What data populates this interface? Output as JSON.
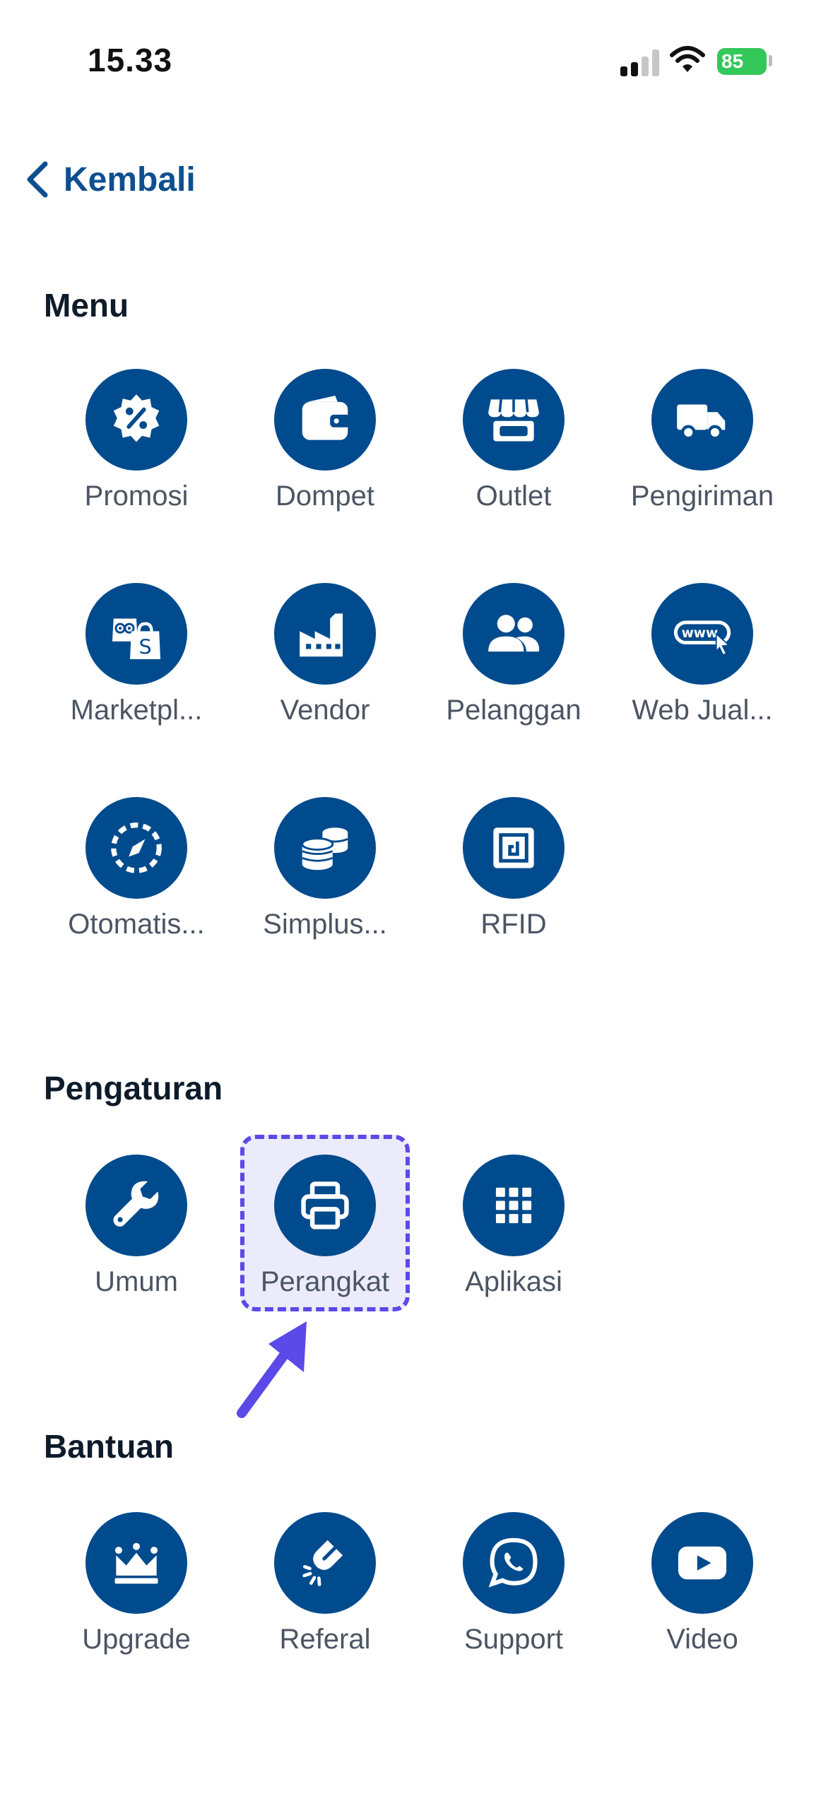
{
  "status_bar": {
    "time": "15.33",
    "battery": "85"
  },
  "nav": {
    "back_label": "Kembali"
  },
  "sections": {
    "menu": {
      "title": "Menu",
      "items": [
        {
          "label": "Promosi",
          "icon": "discount-badge-icon"
        },
        {
          "label": "Dompet",
          "icon": "wallet-icon"
        },
        {
          "label": "Outlet",
          "icon": "store-icon"
        },
        {
          "label": "Pengiriman",
          "icon": "truck-icon"
        },
        {
          "label": "Marketpl...",
          "icon": "marketplace-icon"
        },
        {
          "label": "Vendor",
          "icon": "factory-icon"
        },
        {
          "label": "Pelanggan",
          "icon": "customers-icon"
        },
        {
          "label": "Web Jual...",
          "icon": "web-icon"
        },
        {
          "label": "Otomatis...",
          "icon": "automation-icon"
        },
        {
          "label": "Simplus...",
          "icon": "coins-icon"
        },
        {
          "label": "RFID",
          "icon": "rfid-icon"
        }
      ]
    },
    "pengaturan": {
      "title": "Pengaturan",
      "items": [
        {
          "label": "Umum",
          "icon": "wrench-icon"
        },
        {
          "label": "Perangkat",
          "icon": "printer-icon",
          "highlighted": true
        },
        {
          "label": "Aplikasi",
          "icon": "grid-icon"
        }
      ]
    },
    "bantuan": {
      "title": "Bantuan",
      "items": [
        {
          "label": "Upgrade",
          "icon": "crown-icon"
        },
        {
          "label": "Referal",
          "icon": "magnet-icon"
        },
        {
          "label": "Support",
          "icon": "whatsapp-icon"
        },
        {
          "label": "Video",
          "icon": "youtube-icon"
        }
      ]
    }
  },
  "colors": {
    "icon_bg": "#004b8d",
    "back": "#0e4f8f",
    "highlight": "#5b49e8"
  }
}
